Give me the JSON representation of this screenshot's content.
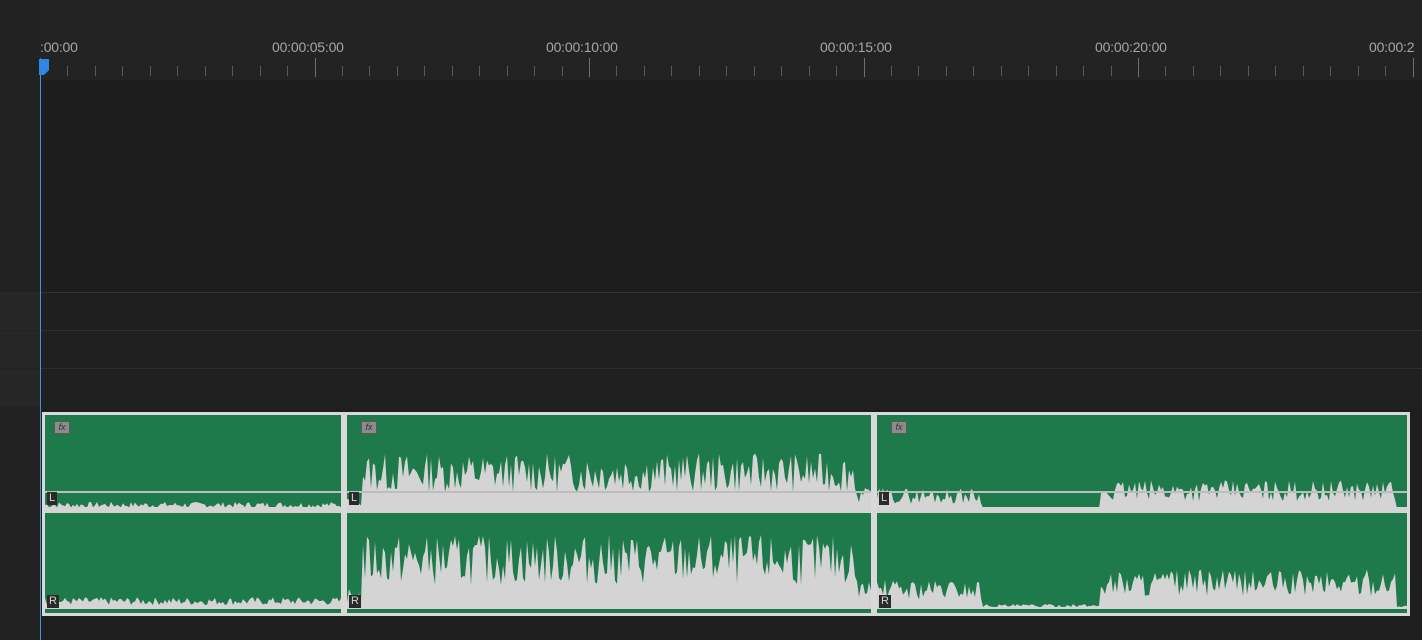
{
  "ruler": {
    "labels": [
      ":00:00",
      "00:00:05:00",
      "00:00:10:00",
      "00:00:15:00",
      "00:00:20:00",
      "00:00:2"
    ]
  },
  "playhead": {
    "time": "00:00:00:00"
  },
  "clips": [
    {
      "id": "clip-1",
      "fx": "fx",
      "left_label": "L",
      "right_label": "R"
    },
    {
      "id": "clip-2",
      "fx": "fx",
      "left_label": "L",
      "right_label": "R"
    },
    {
      "id": "clip-3",
      "fx": "fx",
      "left_label": "L",
      "right_label": "R"
    }
  ],
  "colors": {
    "clip_fill": "#1f7a4b",
    "waveform": "#d4d4d4",
    "playhead": "#2f86e6",
    "background": "#1e1e1e"
  }
}
